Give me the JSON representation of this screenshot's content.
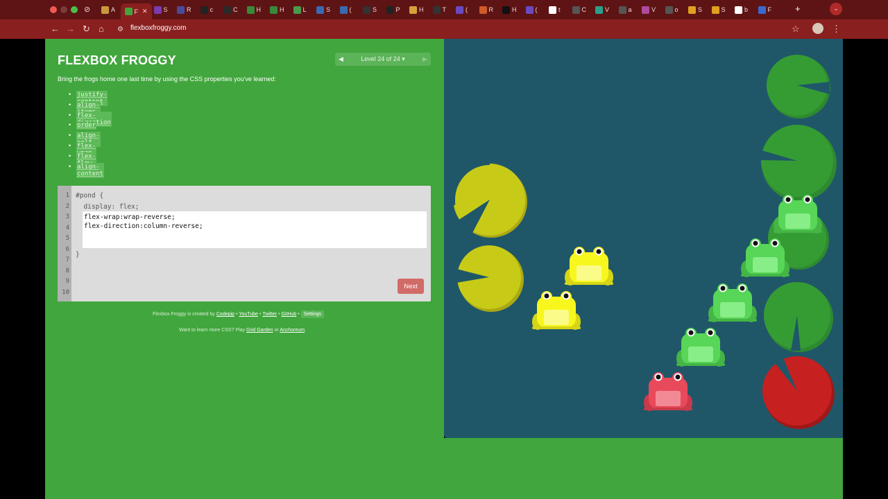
{
  "browser": {
    "tabs": [
      {
        "letter": "A",
        "color": "#c79b3b"
      },
      {
        "letter": "F",
        "color": "#41a63d",
        "active": true,
        "title": "F"
      },
      {
        "letter": "S",
        "color": "#7a3ab0"
      },
      {
        "letter": "R",
        "color": "#4a4a9a"
      },
      {
        "letter": "c",
        "color": "#222222"
      },
      {
        "letter": "C",
        "color": "#2a2a2a"
      },
      {
        "letter": "H",
        "color": "#3a8a3a"
      },
      {
        "letter": "H",
        "color": "#3a8a3a"
      },
      {
        "letter": "L",
        "color": "#4a9a4a"
      },
      {
        "letter": "S",
        "color": "#3a6ab0"
      },
      {
        "letter": "(",
        "color": "#3a6ab0"
      },
      {
        "letter": "S",
        "color": "#333333"
      },
      {
        "letter": "P",
        "color": "#222222"
      },
      {
        "letter": "H",
        "color": "#d7a13a"
      },
      {
        "letter": "T",
        "color": "#333333"
      },
      {
        "letter": "(",
        "color": "#6a4ac0"
      },
      {
        "letter": "R",
        "color": "#d05a2a"
      },
      {
        "letter": "H",
        "color": "#111111"
      },
      {
        "letter": "(",
        "color": "#6a4ac0"
      },
      {
        "letter": "t",
        "color": "#ffffff"
      },
      {
        "letter": "C",
        "color": "#555555"
      },
      {
        "letter": "V",
        "color": "#2aa08a"
      },
      {
        "letter": "a",
        "color": "#555555"
      },
      {
        "letter": "V",
        "color": "#b04a9a"
      },
      {
        "letter": "o",
        "color": "#555555"
      },
      {
        "letter": "S",
        "color": "#e0a020"
      },
      {
        "letter": "S",
        "color": "#e0a020"
      },
      {
        "letter": "b",
        "color": "#ffffff"
      },
      {
        "letter": "F",
        "color": "#3a6ad0"
      }
    ],
    "new_tab": "+",
    "url": "flexboxfroggy.com"
  },
  "game": {
    "logo": "FLEXBOX FROGGY",
    "level_label": "Level 24 of 24",
    "intro": "Bring the frogs home one last time by using the CSS properties you've learned:",
    "properties": [
      "justify-content",
      "align-items",
      "flex-direction",
      "order",
      "align-self",
      "flex-wrap",
      "flex-flow",
      "align-content"
    ],
    "editor": {
      "line_numbers": [
        "1",
        "2",
        "3",
        "4",
        "5",
        "6",
        "7",
        "8",
        "9",
        "10"
      ],
      "line1": "#pond {",
      "line2": "  display: flex;",
      "input_line1": "flex-wrap:wrap-reverse;",
      "input_line2": "flex-direction:column-reverse;",
      "line7": "}"
    },
    "next_label": "Next",
    "footer": {
      "created_prefix": "Flexbox Froggy is created by",
      "codepip": "Codepip",
      "sep": "•",
      "youtube": "YouTube",
      "twitter": "Twitter",
      "github": "GitHub",
      "settings": "Settings",
      "learn_prefix": "Want to learn more CSS? Play",
      "grid_garden": "Grid Garden",
      "or": "or",
      "anchoreum": "Anchoreum",
      "period": "."
    }
  },
  "pond": {
    "frogs": [
      {
        "color": "yellow"
      },
      {
        "color": "yellow"
      },
      {
        "color": "green"
      },
      {
        "color": "green"
      },
      {
        "color": "green"
      },
      {
        "color": "green"
      },
      {
        "color": "red"
      }
    ],
    "lilypads": [
      {
        "color": "yellow"
      },
      {
        "color": "yellow"
      },
      {
        "color": "green"
      },
      {
        "color": "green"
      },
      {
        "color": "green"
      },
      {
        "color": "green"
      },
      {
        "color": "red"
      }
    ]
  },
  "colors": {
    "page_green": "#41a63d",
    "pond_blue": "#1f5768",
    "next_button": "#d16b67",
    "browser_red": "#8a1f1f"
  }
}
